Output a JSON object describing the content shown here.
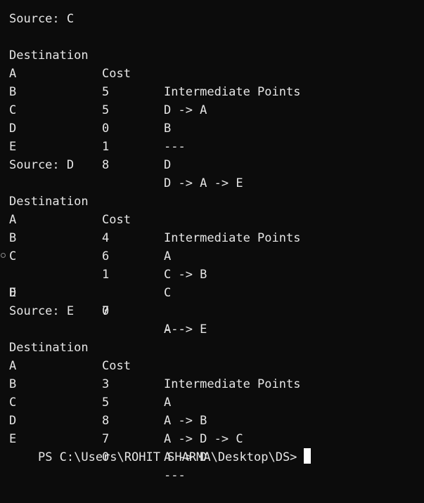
{
  "terminal": {
    "blocks": [
      {
        "source_label": "Source: C",
        "header": {
          "dest": "Destination",
          "cost": "Cost",
          "path": "Intermediate Points"
        },
        "rows": [
          {
            "dest": "A",
            "cost": "5",
            "path": "D -> A"
          },
          {
            "dest": "B",
            "cost": "5",
            "path": "B"
          },
          {
            "dest": "C",
            "cost": "0",
            "path": "---"
          },
          {
            "dest": "D",
            "cost": "1",
            "path": "D"
          },
          {
            "dest": "E",
            "cost": "8",
            "path": "D -> A -> E"
          }
        ]
      },
      {
        "source_label": "Source: D",
        "header": {
          "dest": "Destination",
          "cost": "Cost",
          "path": "Intermediate Points"
        },
        "rows": [
          {
            "dest": "A",
            "cost": "4",
            "path": "A"
          },
          {
            "dest": "B",
            "cost": "6",
            "path": "C -> B"
          },
          {
            "dest": "C",
            "cost": "1",
            "path": "C"
          },
          {
            "dest": "D",
            "cost": "0",
            "path": "---"
          },
          {
            "dest": "E",
            "cost": "7",
            "path": "A -> E"
          }
        ]
      },
      {
        "source_label": "Source: E",
        "header": {
          "dest": "Destination",
          "cost": "Cost",
          "path": "Intermediate Points"
        },
        "rows": [
          {
            "dest": "A",
            "cost": "3",
            "path": "A"
          },
          {
            "dest": "B",
            "cost": "5",
            "path": "A -> B"
          },
          {
            "dest": "C",
            "cost": "8",
            "path": "A -> D -> C"
          },
          {
            "dest": "D",
            "cost": "7",
            "path": "A -> D"
          },
          {
            "dest": "E",
            "cost": "0",
            "path": "---"
          }
        ]
      }
    ],
    "prompt": "PS C:\\Users\\ROHIT SHARMA\\Desktop\\DS>"
  }
}
